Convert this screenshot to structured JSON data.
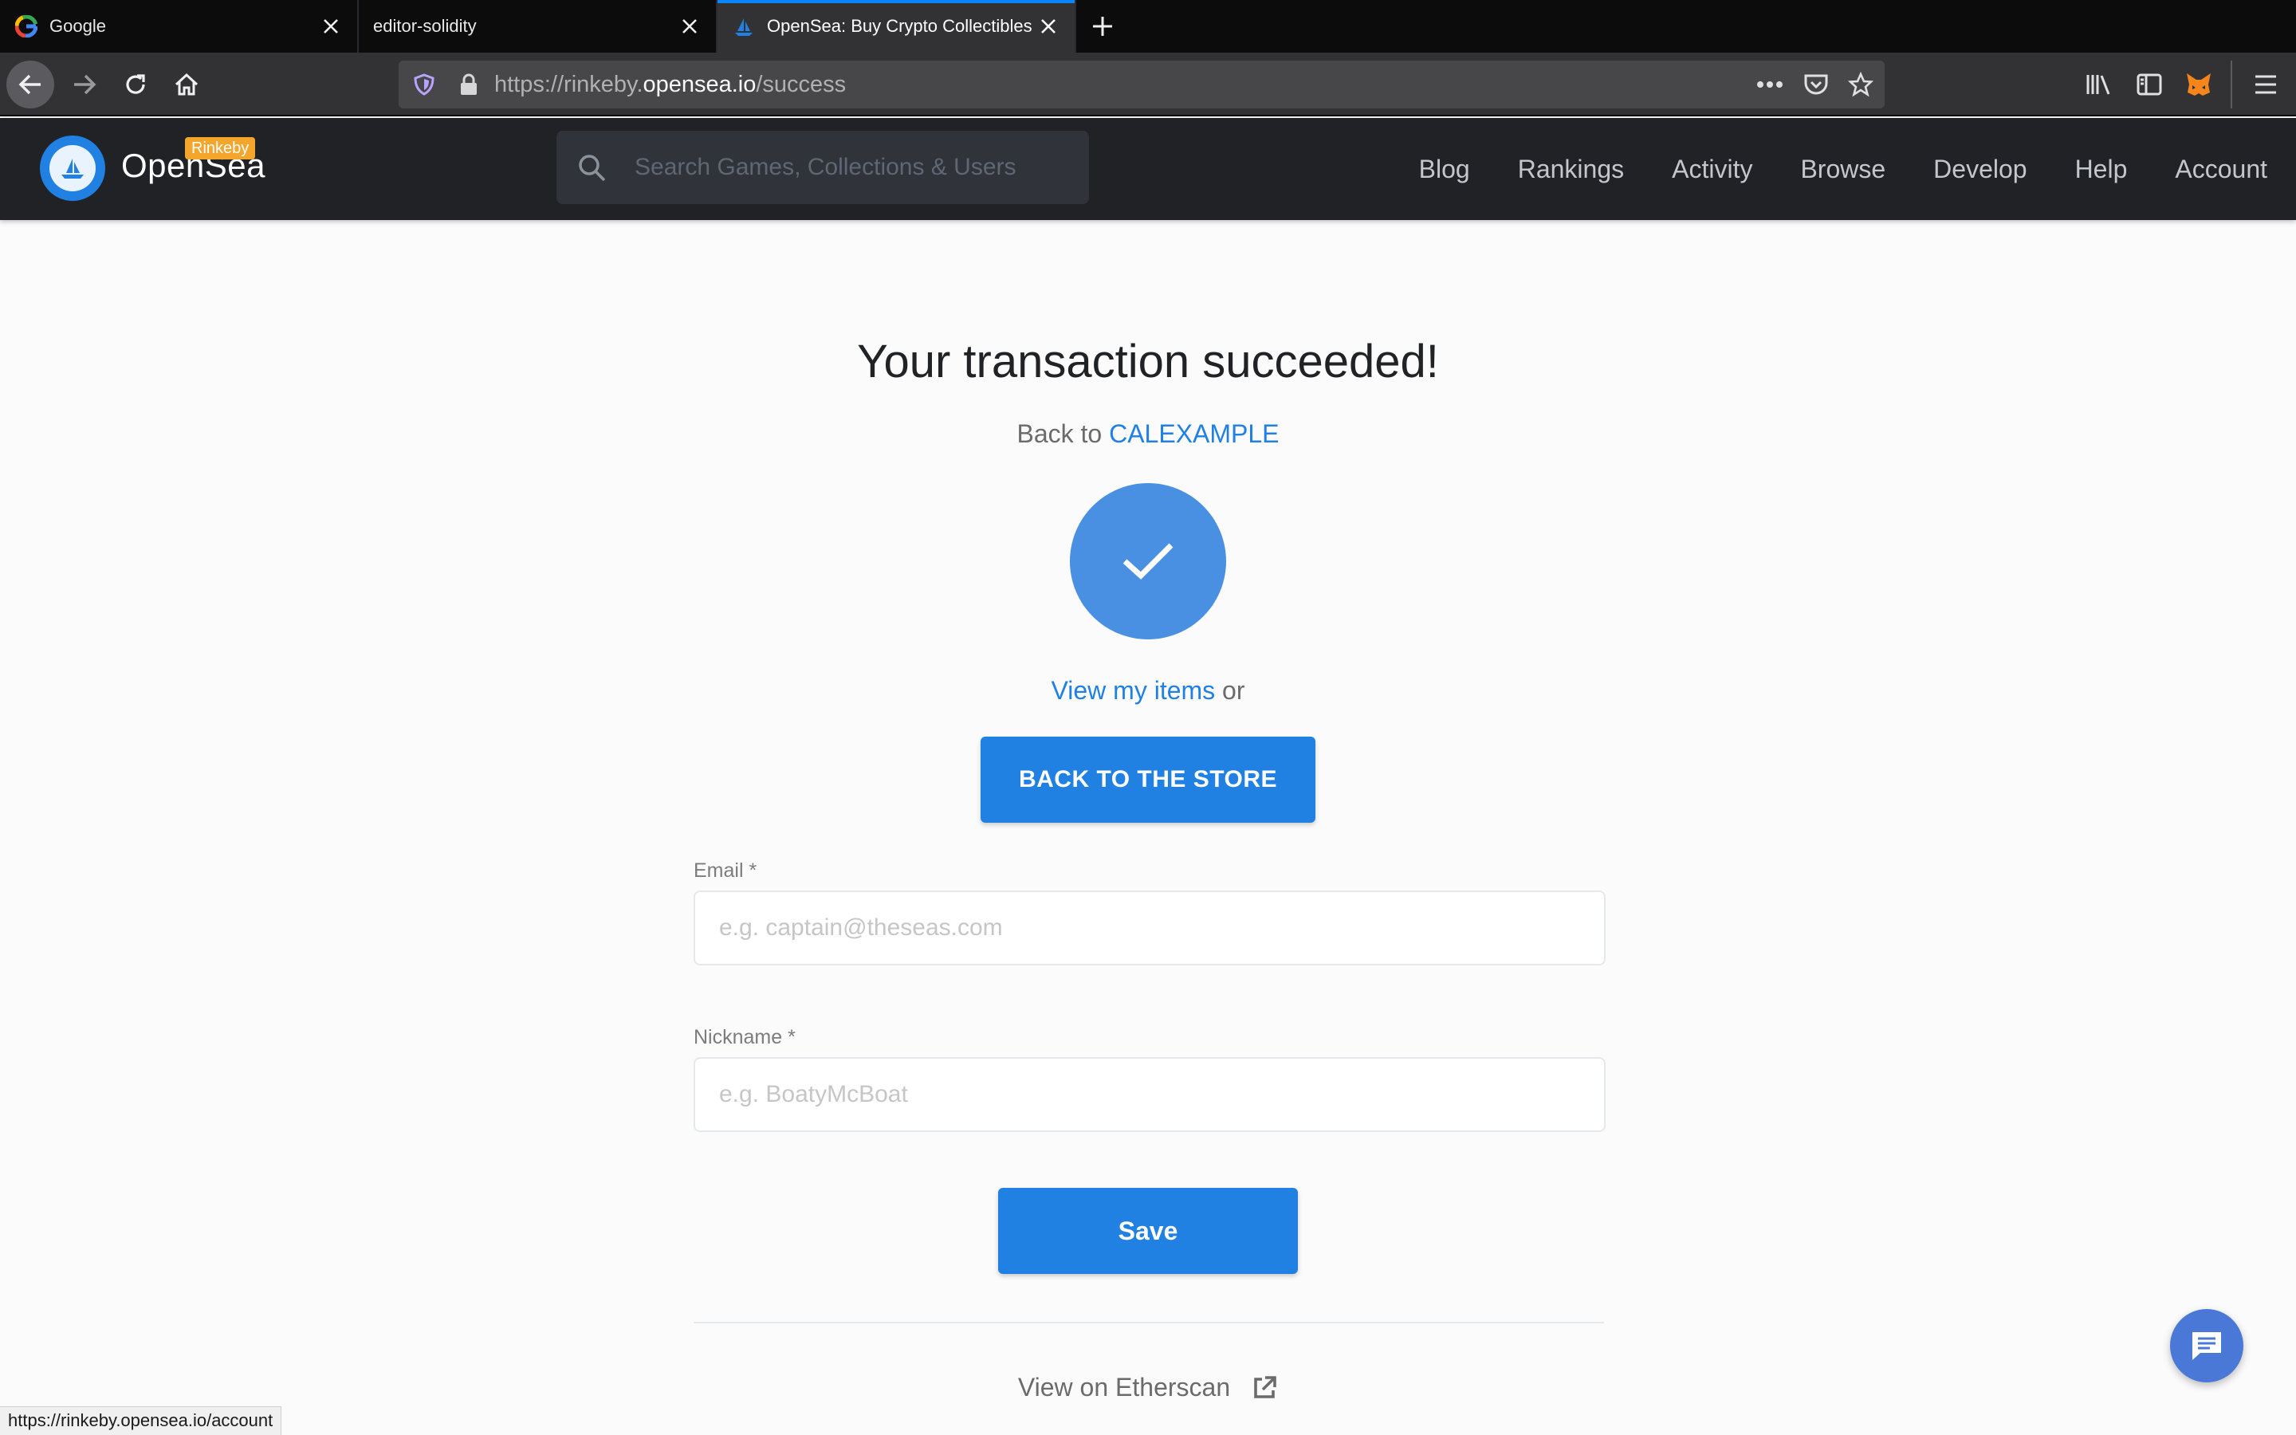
{
  "browser": {
    "tabs": [
      {
        "title": "Google",
        "favicon": "google-icon",
        "active": false
      },
      {
        "title": "editor-solidity",
        "favicon": "",
        "active": false
      },
      {
        "title": "OpenSea: Buy Crypto Collectibles",
        "favicon": "opensea-icon",
        "active": true
      }
    ],
    "url": {
      "prefix": "https://rinkeby.",
      "host": "opensea.io",
      "path": "/success"
    },
    "status_url": "https://rinkeby.opensea.io/account"
  },
  "header": {
    "brand": "OpenSea",
    "network_badge": "Rinkeby",
    "search_placeholder": "Search Games, Collections & Users",
    "nav": [
      "Blog",
      "Rankings",
      "Activity",
      "Browse",
      "Develop",
      "Help",
      "Account"
    ]
  },
  "success": {
    "title": "Your transaction succeeded!",
    "back_prefix": "Back to",
    "back_link": "CALEXAMPLE",
    "view_items_link": "View my items",
    "view_items_suffix": "or",
    "store_button": "BACK TO THE STORE"
  },
  "form": {
    "email_label": "Email *",
    "email_placeholder": "e.g. captain@theseas.com",
    "nickname_label": "Nickname *",
    "nickname_placeholder": "e.g. BoatyMcBoat",
    "save_button": "Save"
  },
  "footer": {
    "etherscan_link": "View on Etherscan"
  },
  "colors": {
    "accent": "#2081e2",
    "header_bg": "#202225",
    "badge": "#f4a52c",
    "check_circle": "#4a90e2"
  }
}
